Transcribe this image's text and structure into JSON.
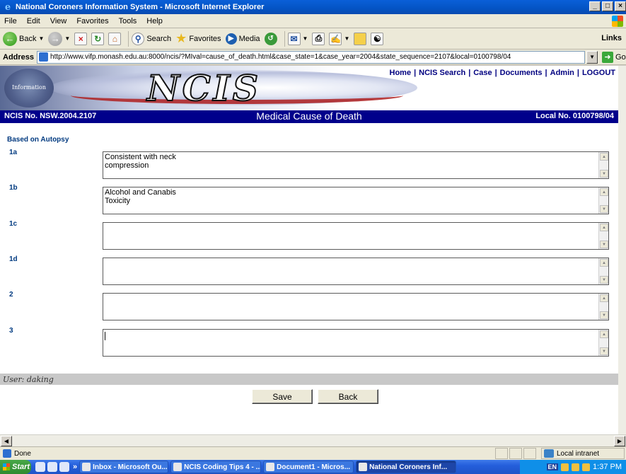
{
  "window": {
    "title": "National Coroners Information System - Microsoft Internet Explorer",
    "controls": [
      "_",
      "×",
      "×"
    ]
  },
  "menu": [
    "File",
    "Edit",
    "View",
    "Favorites",
    "Tools",
    "Help"
  ],
  "toolbar": {
    "back": "Back",
    "search": "Search",
    "favorites": "Favorites",
    "media": "Media",
    "links": "Links"
  },
  "address": {
    "label": "Address",
    "url": "http://www.vifp.monash.edu.au:8000/ncis/?MIval=cause_of_death.html&case_state=1&case_year=2004&state_sequence=2107&local=0100798/04",
    "go": "Go"
  },
  "page": {
    "logo_text": "Information",
    "brand": "NCIS",
    "nav": [
      "Home",
      "NCIS Search",
      "Case",
      "Documents",
      "Admin",
      "LOGOUT"
    ],
    "ncis_no": "NCIS No. NSW.2004.2107",
    "section_title": "Medical Cause of Death",
    "local_no": "Local No. 0100798/04",
    "based_on": "Based on Autopsy",
    "causes": [
      {
        "label": "1a",
        "value": "Consistent with neck\ncompression"
      },
      {
        "label": "1b",
        "value": "Alcohol and Canabis\nToxicity"
      },
      {
        "label": "1c",
        "value": ""
      },
      {
        "label": "1d",
        "value": ""
      },
      {
        "label": "2",
        "value": ""
      },
      {
        "label": "3",
        "value": ""
      }
    ],
    "user": "User: daking",
    "save": "Save",
    "back": "Back"
  },
  "status": {
    "text": "Done",
    "zone": "Local intranet"
  },
  "taskbar": {
    "start": "Start",
    "tasks": [
      "Inbox - Microsoft Ou...",
      "NCIS Coding Tips 4 - ...",
      "Document1 - Micros...",
      "National Coroners Inf..."
    ],
    "lang": "EN",
    "time": "1:37 PM"
  }
}
